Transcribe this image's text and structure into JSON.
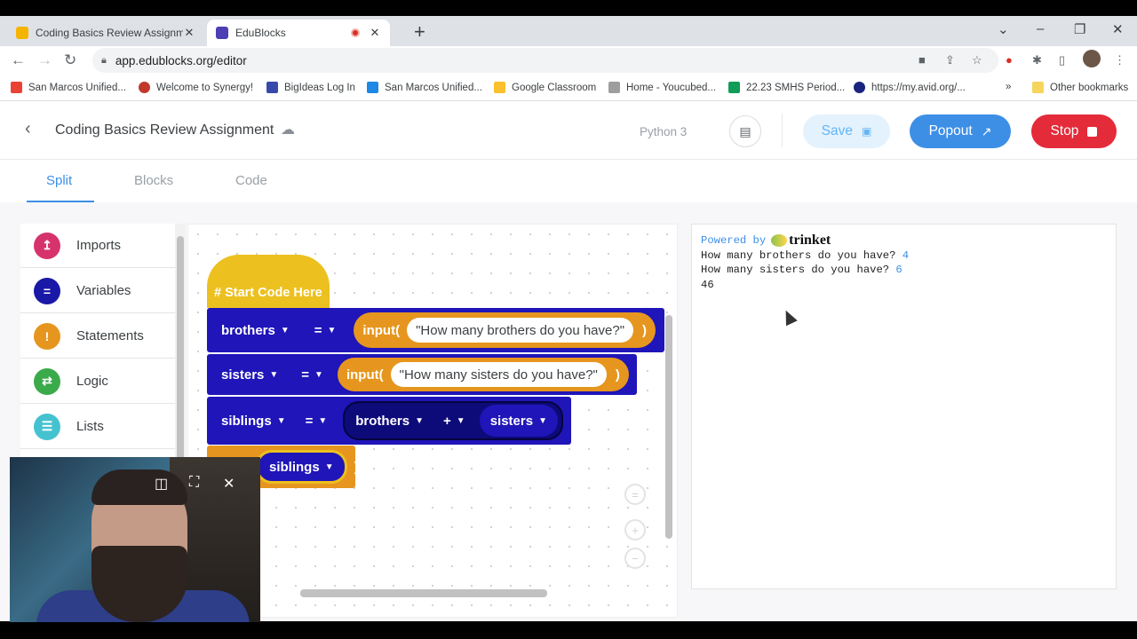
{
  "browser": {
    "tabs": [
      {
        "title": "Coding Basics Review Assignmen",
        "favicon_color": "#f4b400",
        "active": false
      },
      {
        "title": "EduBlocks",
        "favicon_color": "#4b3fb3",
        "active": true
      }
    ],
    "new_tab_icon": "+",
    "window_controls": {
      "chevron": "⌄",
      "minimize": "–",
      "restore": "❐",
      "close": "✕"
    },
    "url": "app.edublocks.org/editor",
    "bookmarks": [
      {
        "label": "San Marcos Unified...",
        "icon_color": "#ea4335"
      },
      {
        "label": "Welcome to Synergy!",
        "icon_color": "#c0392b"
      },
      {
        "label": "BigIdeas Log In",
        "icon_color": "#3949ab"
      },
      {
        "label": "San Marcos Unified...",
        "icon_color": "#1e88e5"
      },
      {
        "label": "Google Classroom",
        "icon_color": "#fbc02d"
      },
      {
        "label": "Home - Youcubed...",
        "icon_color": "#9e9e9e"
      },
      {
        "label": "22.23 SMHS Period...",
        "icon_color": "#0f9d58"
      },
      {
        "label": "https://my.avid.org/...",
        "icon_color": "#1a237e"
      },
      {
        "label": "Other bookmarks",
        "icon_color": "#f6d55c"
      }
    ],
    "bookmarks_overflow": "»"
  },
  "app": {
    "title": "Coding Basics Review Assignment",
    "language": "Python 3",
    "save_label": "Save",
    "popout_label": "Popout",
    "stop_label": "Stop",
    "tabs": [
      "Split",
      "Blocks",
      "Code"
    ],
    "active_tab": "Split"
  },
  "toolbox": [
    {
      "label": "Imports",
      "color": "#d6336c",
      "icon": "↥"
    },
    {
      "label": "Variables",
      "color": "#1a18a6",
      "icon": "="
    },
    {
      "label": "Statements",
      "color": "#e6961e",
      "icon": "!"
    },
    {
      "label": "Logic",
      "color": "#3aaa4a",
      "icon": "⇄"
    },
    {
      "label": "Lists",
      "color": "#45c2d0",
      "icon": "☰"
    }
  ],
  "blocks": {
    "hat": "# Start Code Here",
    "row1": {
      "var": "brothers",
      "op": "=",
      "fn": "input(",
      "str": "How many brothers do you have?",
      "close": ")"
    },
    "row2": {
      "var": "sisters",
      "op": "=",
      "fn": "input(",
      "str": "How many sisters do you have?",
      "close": ")"
    },
    "row3": {
      "var": "siblings",
      "op": "=",
      "a": "brothers",
      "plus": "+",
      "b": "sisters"
    },
    "row4": {
      "arg": "siblings",
      "close": ")"
    }
  },
  "output": {
    "powered_by": "Powered by",
    "brand": "trinket",
    "lines": [
      {
        "prompt": "How many brothers do you have? ",
        "answer": "4"
      },
      {
        "prompt": "How many sisters do you have? ",
        "answer": "6"
      },
      {
        "prompt": "46",
        "answer": ""
      }
    ]
  }
}
